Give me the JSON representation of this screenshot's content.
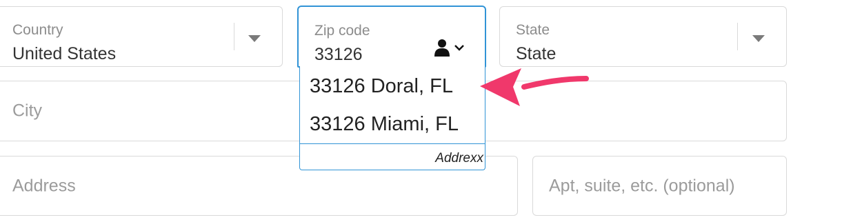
{
  "country": {
    "label": "Country",
    "value": "United States"
  },
  "zip": {
    "label": "Zip code",
    "value": "33126"
  },
  "state": {
    "label": "State",
    "value": "State"
  },
  "suggestions": {
    "items": [
      "33126 Doral, FL",
      "33126 Miami, FL"
    ],
    "brand": "Addrexx"
  },
  "city": {
    "placeholder": "City"
  },
  "address": {
    "placeholder": "Address"
  },
  "apt": {
    "placeholder": "Apt, suite, etc. (optional)"
  },
  "colors": {
    "focus": "#3093d6",
    "arrow": "#f0386b"
  },
  "icons": [
    "chevron-down-icon",
    "person-icon",
    "arrow-pointer-icon"
  ]
}
